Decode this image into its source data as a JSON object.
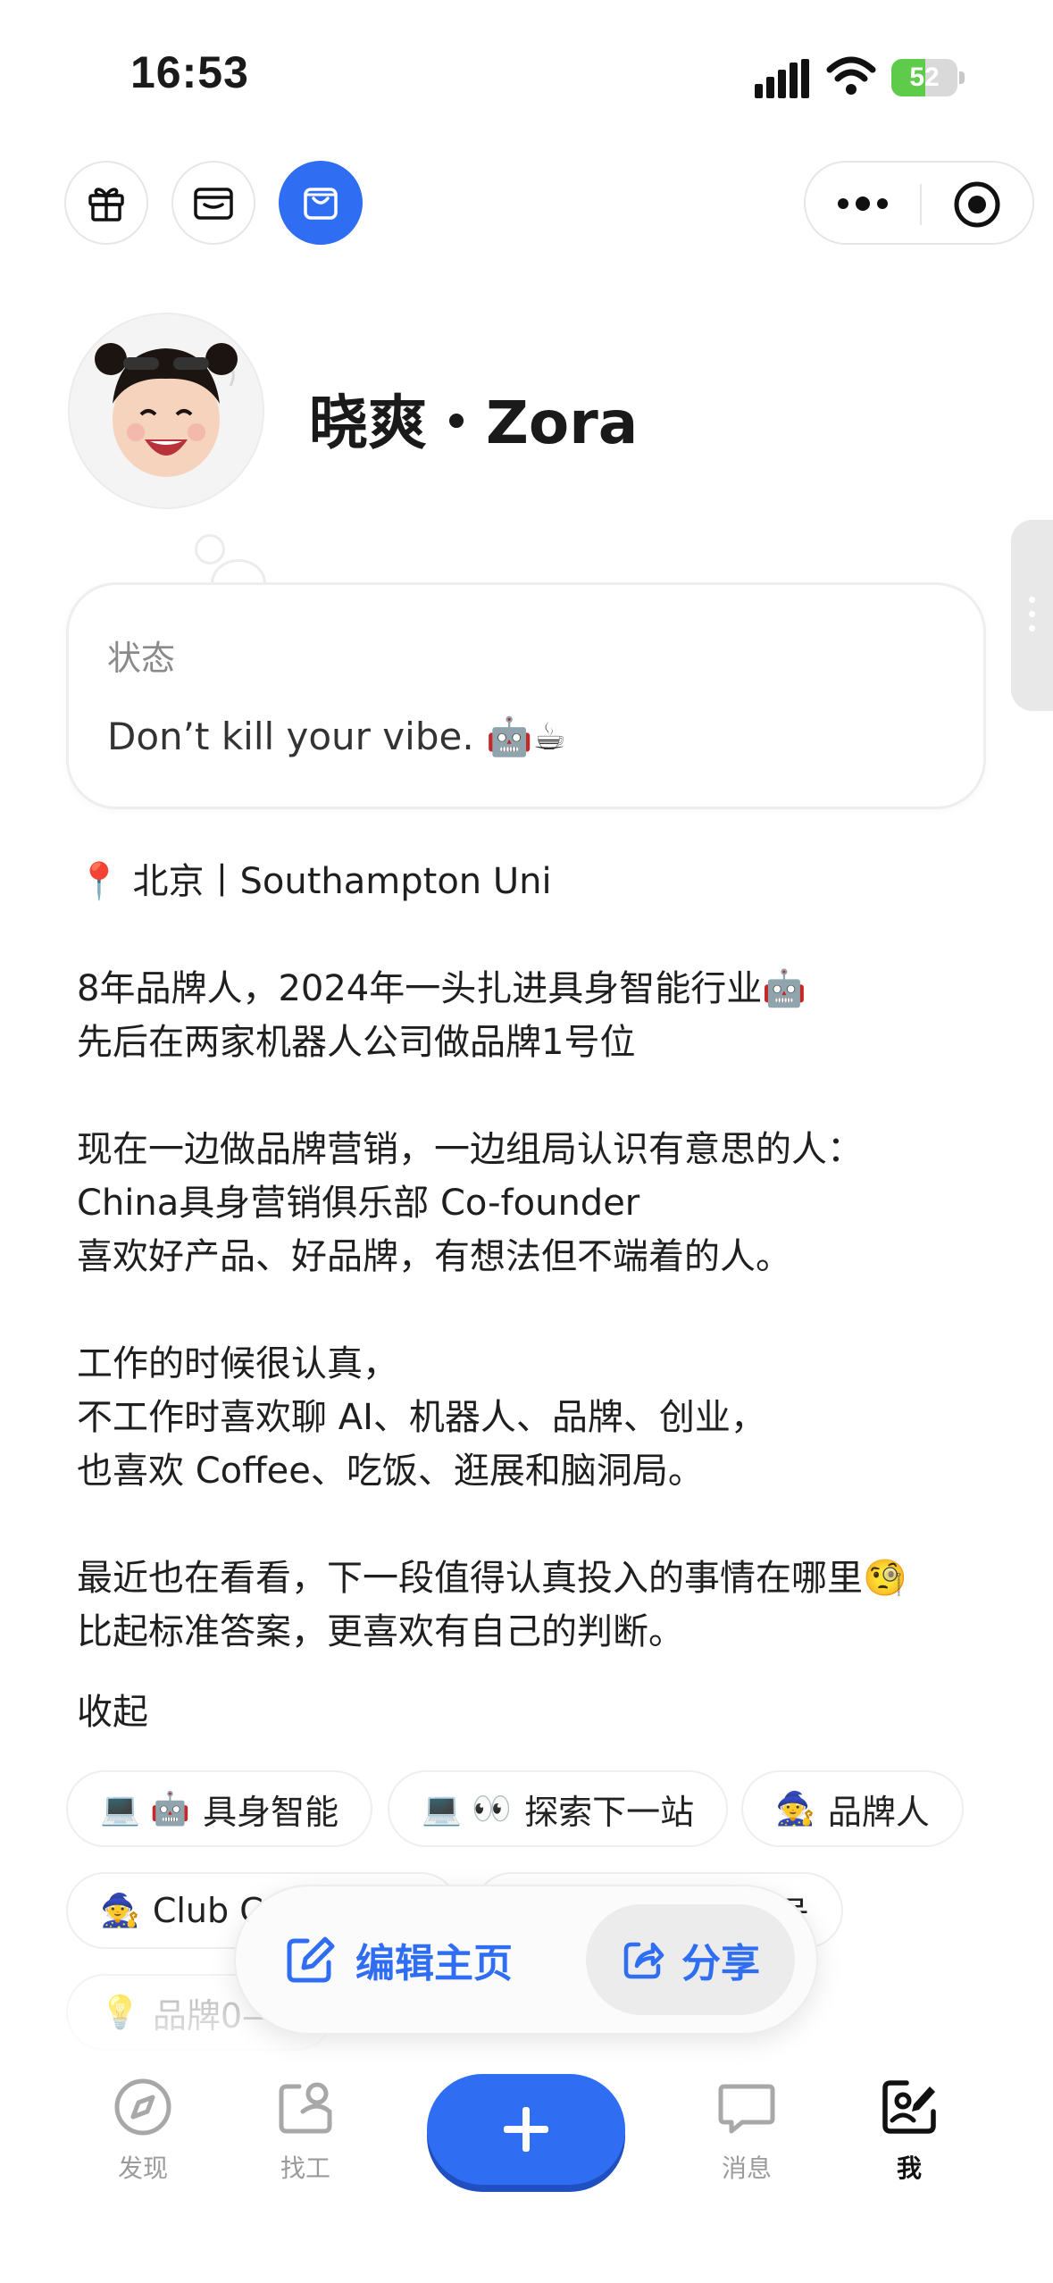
{
  "status_bar": {
    "time": "16:53",
    "battery": "52",
    "battery_level": 0.52
  },
  "top_bar": {
    "icons": [
      "gift-icon",
      "wallet-icon",
      "shopping-bag-icon",
      "more-dots-icon",
      "target-icon"
    ]
  },
  "profile": {
    "name": "晓爽・Zora",
    "status_label": "状态",
    "status_text": "Don’t kill your vibe. 🤖☕"
  },
  "bio": {
    "location_line": "📍 北京丨Southampton Uni",
    "lines": [
      "8年品牌人，2024年一头扎进具身智能行业🤖",
      "先后在两家机器人公司做品牌1号位",
      "现在一边做品牌营销，一边组局认识有意思的人：",
      "China具身营销俱乐部 Co-founder",
      "喜欢好产品、好品牌，有想法但不端着的人。",
      "工作的时候很认真，",
      "不工作时喜欢聊 AI、机器人、品牌、创业，",
      "也喜欢 Coffee、吃饭、逛展和脑洞局。",
      "最近也在看看，下一段值得认真投入的事情在哪里🧐",
      "比起标准答案，更喜欢有自己的判断。"
    ],
    "collapse_label": "收起"
  },
  "tags": [
    {
      "icon": "💻 🤖",
      "label": "具身智能"
    },
    {
      "icon": "💻 👀",
      "label": "探索下一站"
    },
    {
      "icon": "🧙",
      "label": "品牌人"
    },
    {
      "icon": "🧙",
      "label": "Club C"
    },
    {
      "icon": "",
      "label": "号"
    },
    {
      "icon": "💡",
      "label": "品牌0—"
    }
  ],
  "actions": {
    "edit_label": "编辑主页",
    "share_label": "分享"
  },
  "bottom_nav": {
    "items": [
      {
        "label": "发现",
        "icon": "compass-icon"
      },
      {
        "label": "找工",
        "icon": "job-icon"
      },
      {
        "label": "",
        "icon": "plus-icon"
      },
      {
        "label": "消息",
        "icon": "message-icon"
      },
      {
        "label": "我",
        "icon": "profile-edit-icon"
      }
    ]
  },
  "colors": {
    "accent": "#2f6ef2",
    "battery": "#5ecb4a"
  }
}
